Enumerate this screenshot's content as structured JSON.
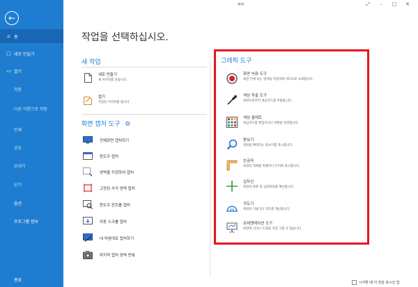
{
  "app": {
    "title": "픽픽"
  },
  "window_controls": {
    "icons": [
      "pin-icon",
      "minimize-icon",
      "maximize-icon",
      "close-icon"
    ]
  },
  "sidebar": {
    "back_icon": "back-arrow-icon",
    "items": [
      {
        "label": "홈",
        "icon": "home-icon"
      },
      {
        "label": "새로 만들기",
        "icon": "new-file-icon"
      },
      {
        "label": "열기",
        "icon": "folder-icon"
      },
      {
        "label": "저장"
      },
      {
        "label": "다른 이름으로 저장"
      },
      {
        "label": "인쇄"
      },
      {
        "label": "공유"
      },
      {
        "label": "보내기"
      },
      {
        "label": "닫기"
      },
      {
        "label": "옵션"
      },
      {
        "label": "프로그램 정보"
      },
      {
        "label": "종료"
      }
    ]
  },
  "main": {
    "title": "작업을 선택하십시오.",
    "new_task": {
      "heading": "새 작업",
      "items": [
        {
          "name": "새로 만들기",
          "desc": "새 이미지를 만듭니다."
        },
        {
          "name": "열기",
          "desc": "저장된 이미지를 엽니다."
        }
      ]
    },
    "capture": {
      "heading": "화면 캡처 도구",
      "settings_icon": "gear-icon",
      "items": [
        {
          "label": "전체화면 캡처하기"
        },
        {
          "label": "윈도우 캡처"
        },
        {
          "label": "영역을 지정하여 캡처"
        },
        {
          "label": "고정된 사각 영역 캡처"
        },
        {
          "label": "윈도우 컨트롤 캡처"
        },
        {
          "label": "자동 스크롤 캡처"
        },
        {
          "label": "내 마음대로 캡처하기"
        },
        {
          "label": "마지막 캡처 영역 반복"
        }
      ]
    },
    "graphic": {
      "heading": "그래픽 도구",
      "items": [
        {
          "name": "화면 녹화 도구",
          "desc": "화면 전체 또는 영역을 지정하여 비디오로 녹화합니다.",
          "icon": "record-icon"
        },
        {
          "name": "색상 추출 도구",
          "desc": "화면으로부터 색상코드를 추출합니다.",
          "icon": "eyedropper-icon"
        },
        {
          "name": "색상 팔레트",
          "desc": "색상코드를 편집하거나 변환을 변경합니다.",
          "icon": "palette-icon"
        },
        {
          "name": "돋보기",
          "desc": "화면을 확대하는 돋보기를 표시합니다.",
          "icon": "magnifier-icon"
        },
        {
          "name": "눈금자",
          "desc": "화면의 객체를 픽셀이나 인치로 표시합니다.",
          "icon": "ruler-icon"
        },
        {
          "name": "십자선",
          "desc": "화면의 좌표 및 상대좌표를 계산합니다.",
          "icon": "crosshair-icon"
        },
        {
          "name": "각도기",
          "desc": "화면의 기울기나 각도를 계산합니다.",
          "icon": "protractor-icon"
        },
        {
          "name": "프레젠테이션 도구",
          "desc": "화면에 선이나 도형을 직접 그릴 수 있습니다.",
          "icon": "whiteboard-icon"
        }
      ]
    }
  },
  "footer": {
    "checkbox_label": "시작할 때 이 창을 표시안 함"
  },
  "colors": {
    "sidebar": "#1e7dd0",
    "accent": "#1e7dd0",
    "highlight_border": "#e6141b"
  }
}
